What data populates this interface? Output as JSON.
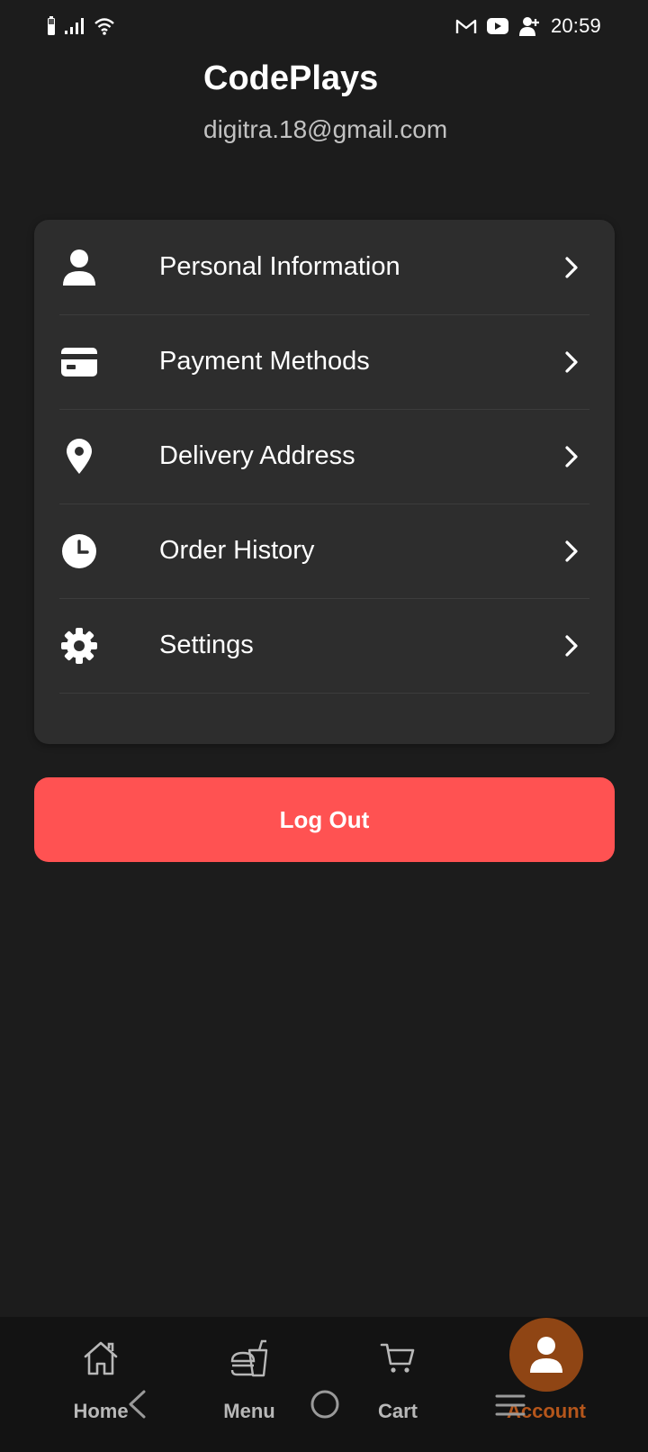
{
  "status_bar": {
    "time": "20:59",
    "icons": [
      "battery-icon",
      "signal-icon",
      "wifi-icon",
      "gmail-icon",
      "youtube-icon",
      "person-add-icon"
    ]
  },
  "profile": {
    "name": "CodePlays",
    "email": "digitra.18@gmail.com"
  },
  "menu": {
    "items": [
      {
        "label": "Personal Information",
        "icon": "person-icon"
      },
      {
        "label": "Payment Methods",
        "icon": "credit-card-icon"
      },
      {
        "label": "Delivery Address",
        "icon": "location-pin-icon"
      },
      {
        "label": "Order History",
        "icon": "clock-icon"
      },
      {
        "label": "Settings",
        "icon": "gear-icon"
      }
    ]
  },
  "logout": {
    "label": "Log Out",
    "color": "#ff5252"
  },
  "bottom_nav": {
    "items": [
      {
        "label": "Home",
        "icon": "home-icon",
        "active": false
      },
      {
        "label": "Menu",
        "icon": "fastfood-icon",
        "active": false
      },
      {
        "label": "Cart",
        "icon": "cart-icon",
        "active": false
      },
      {
        "label": "Account",
        "icon": "account-icon",
        "active": true
      }
    ],
    "active_color": "#b5561b"
  },
  "system_nav": {
    "buttons": [
      "back-icon",
      "home-circle-icon",
      "recents-icon"
    ]
  },
  "colors": {
    "background": "#1c1c1c",
    "card": "#2d2d2d",
    "accent": "#ff5252",
    "active_tab": "#8f4514"
  }
}
